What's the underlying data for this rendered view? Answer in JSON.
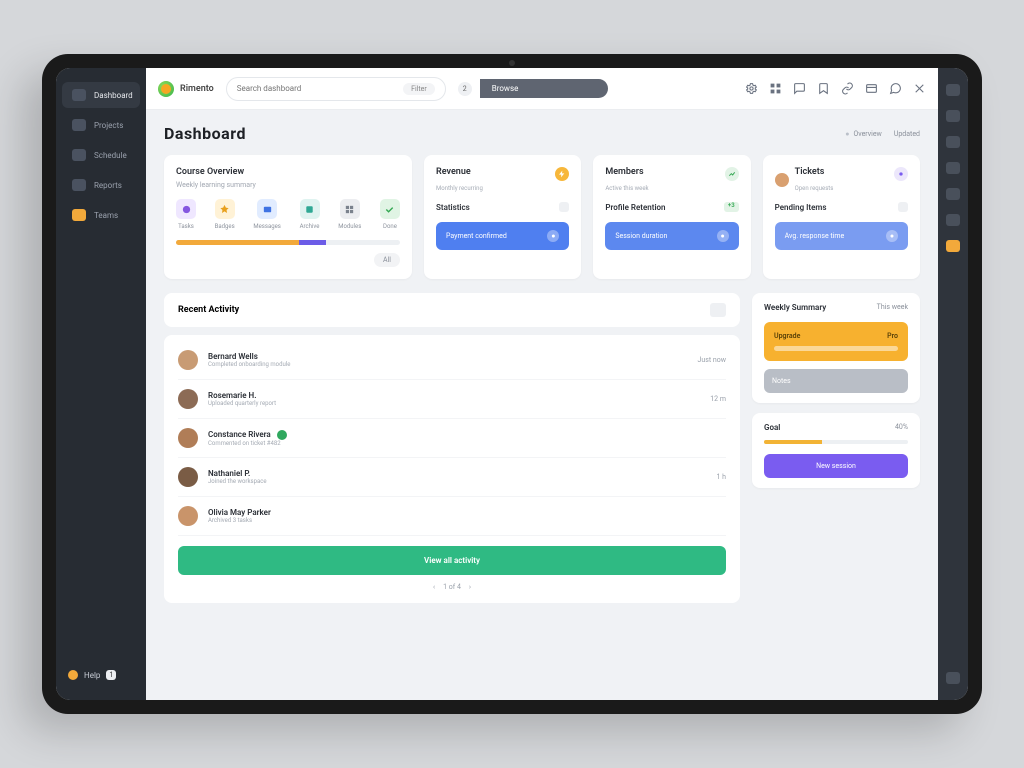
{
  "brand": {
    "name": "Rimento"
  },
  "search": {
    "placeholder": "Search dashboard",
    "filter_label": "Filter"
  },
  "topbar": {
    "badge": "2",
    "tab_label": "Browse"
  },
  "top_icons": [
    "settings",
    "grid",
    "chat",
    "bookmark",
    "link",
    "card",
    "comment",
    "more"
  ],
  "sidebar": {
    "items": [
      {
        "label": "Dashboard",
        "active": true
      },
      {
        "label": "Projects"
      },
      {
        "label": "Schedule"
      },
      {
        "label": "Reports"
      },
      {
        "label": "Teams",
        "highlight": true
      }
    ],
    "footer_label": "Help",
    "footer_badge": "1"
  },
  "page": {
    "title": "Dashboard",
    "meta_left": "Overview",
    "meta_right": "Updated"
  },
  "overview": {
    "title": "Course Overview",
    "subtitle": "Weekly learning summary",
    "metrics": [
      {
        "label": "Tasks"
      },
      {
        "label": "Badges"
      },
      {
        "label": "Messages"
      },
      {
        "label": "Archive"
      },
      {
        "label": "Modules"
      },
      {
        "label": "Done"
      }
    ],
    "chip": "All"
  },
  "stats": [
    {
      "title": "Revenue",
      "subtitle": "Monthly recurring",
      "mid": "Statistics",
      "foot": "Payment confirmed",
      "dot": "d-yel",
      "footcls": "sf-blue"
    },
    {
      "title": "Members",
      "subtitle": "Active this week",
      "mid": "Profile Retention",
      "foot": "Session duration",
      "dot": "d-grn",
      "footcls": "sf-blue2",
      "badge": "+3"
    },
    {
      "title": "Tickets",
      "subtitle": "Open requests",
      "mid": "Pending Items",
      "foot": "Avg. response time",
      "dot": "d-pur",
      "footcls": "sf-blue3",
      "avatar": true
    }
  ],
  "activity": {
    "title": "Recent Activity",
    "items": [
      {
        "name": "Bernard Wells",
        "sub": "Completed onboarding module",
        "meta": "Just now"
      },
      {
        "name": "Rosemarie H.",
        "sub": "Uploaded quarterly report",
        "meta": "12 m"
      },
      {
        "name": "Constance Rivera",
        "sub": "Commented on ticket #482",
        "meta": "",
        "tag": true
      },
      {
        "name": "Nathaniel P.",
        "sub": "Joined the workspace",
        "meta": "1 h"
      },
      {
        "name": "Olivia May Parker",
        "sub": "Archived 3 tasks",
        "meta": ""
      }
    ],
    "cta": "View all activity",
    "pager_hint": "1 of 4"
  },
  "aside": {
    "summary_title": "Weekly Summary",
    "summary_meta": "This week",
    "promo_title": "Upgrade",
    "promo_meta": "Pro",
    "secondary_title": "Notes",
    "goal_title": "Goal",
    "goal_percent": "40%",
    "cta": "New session"
  }
}
